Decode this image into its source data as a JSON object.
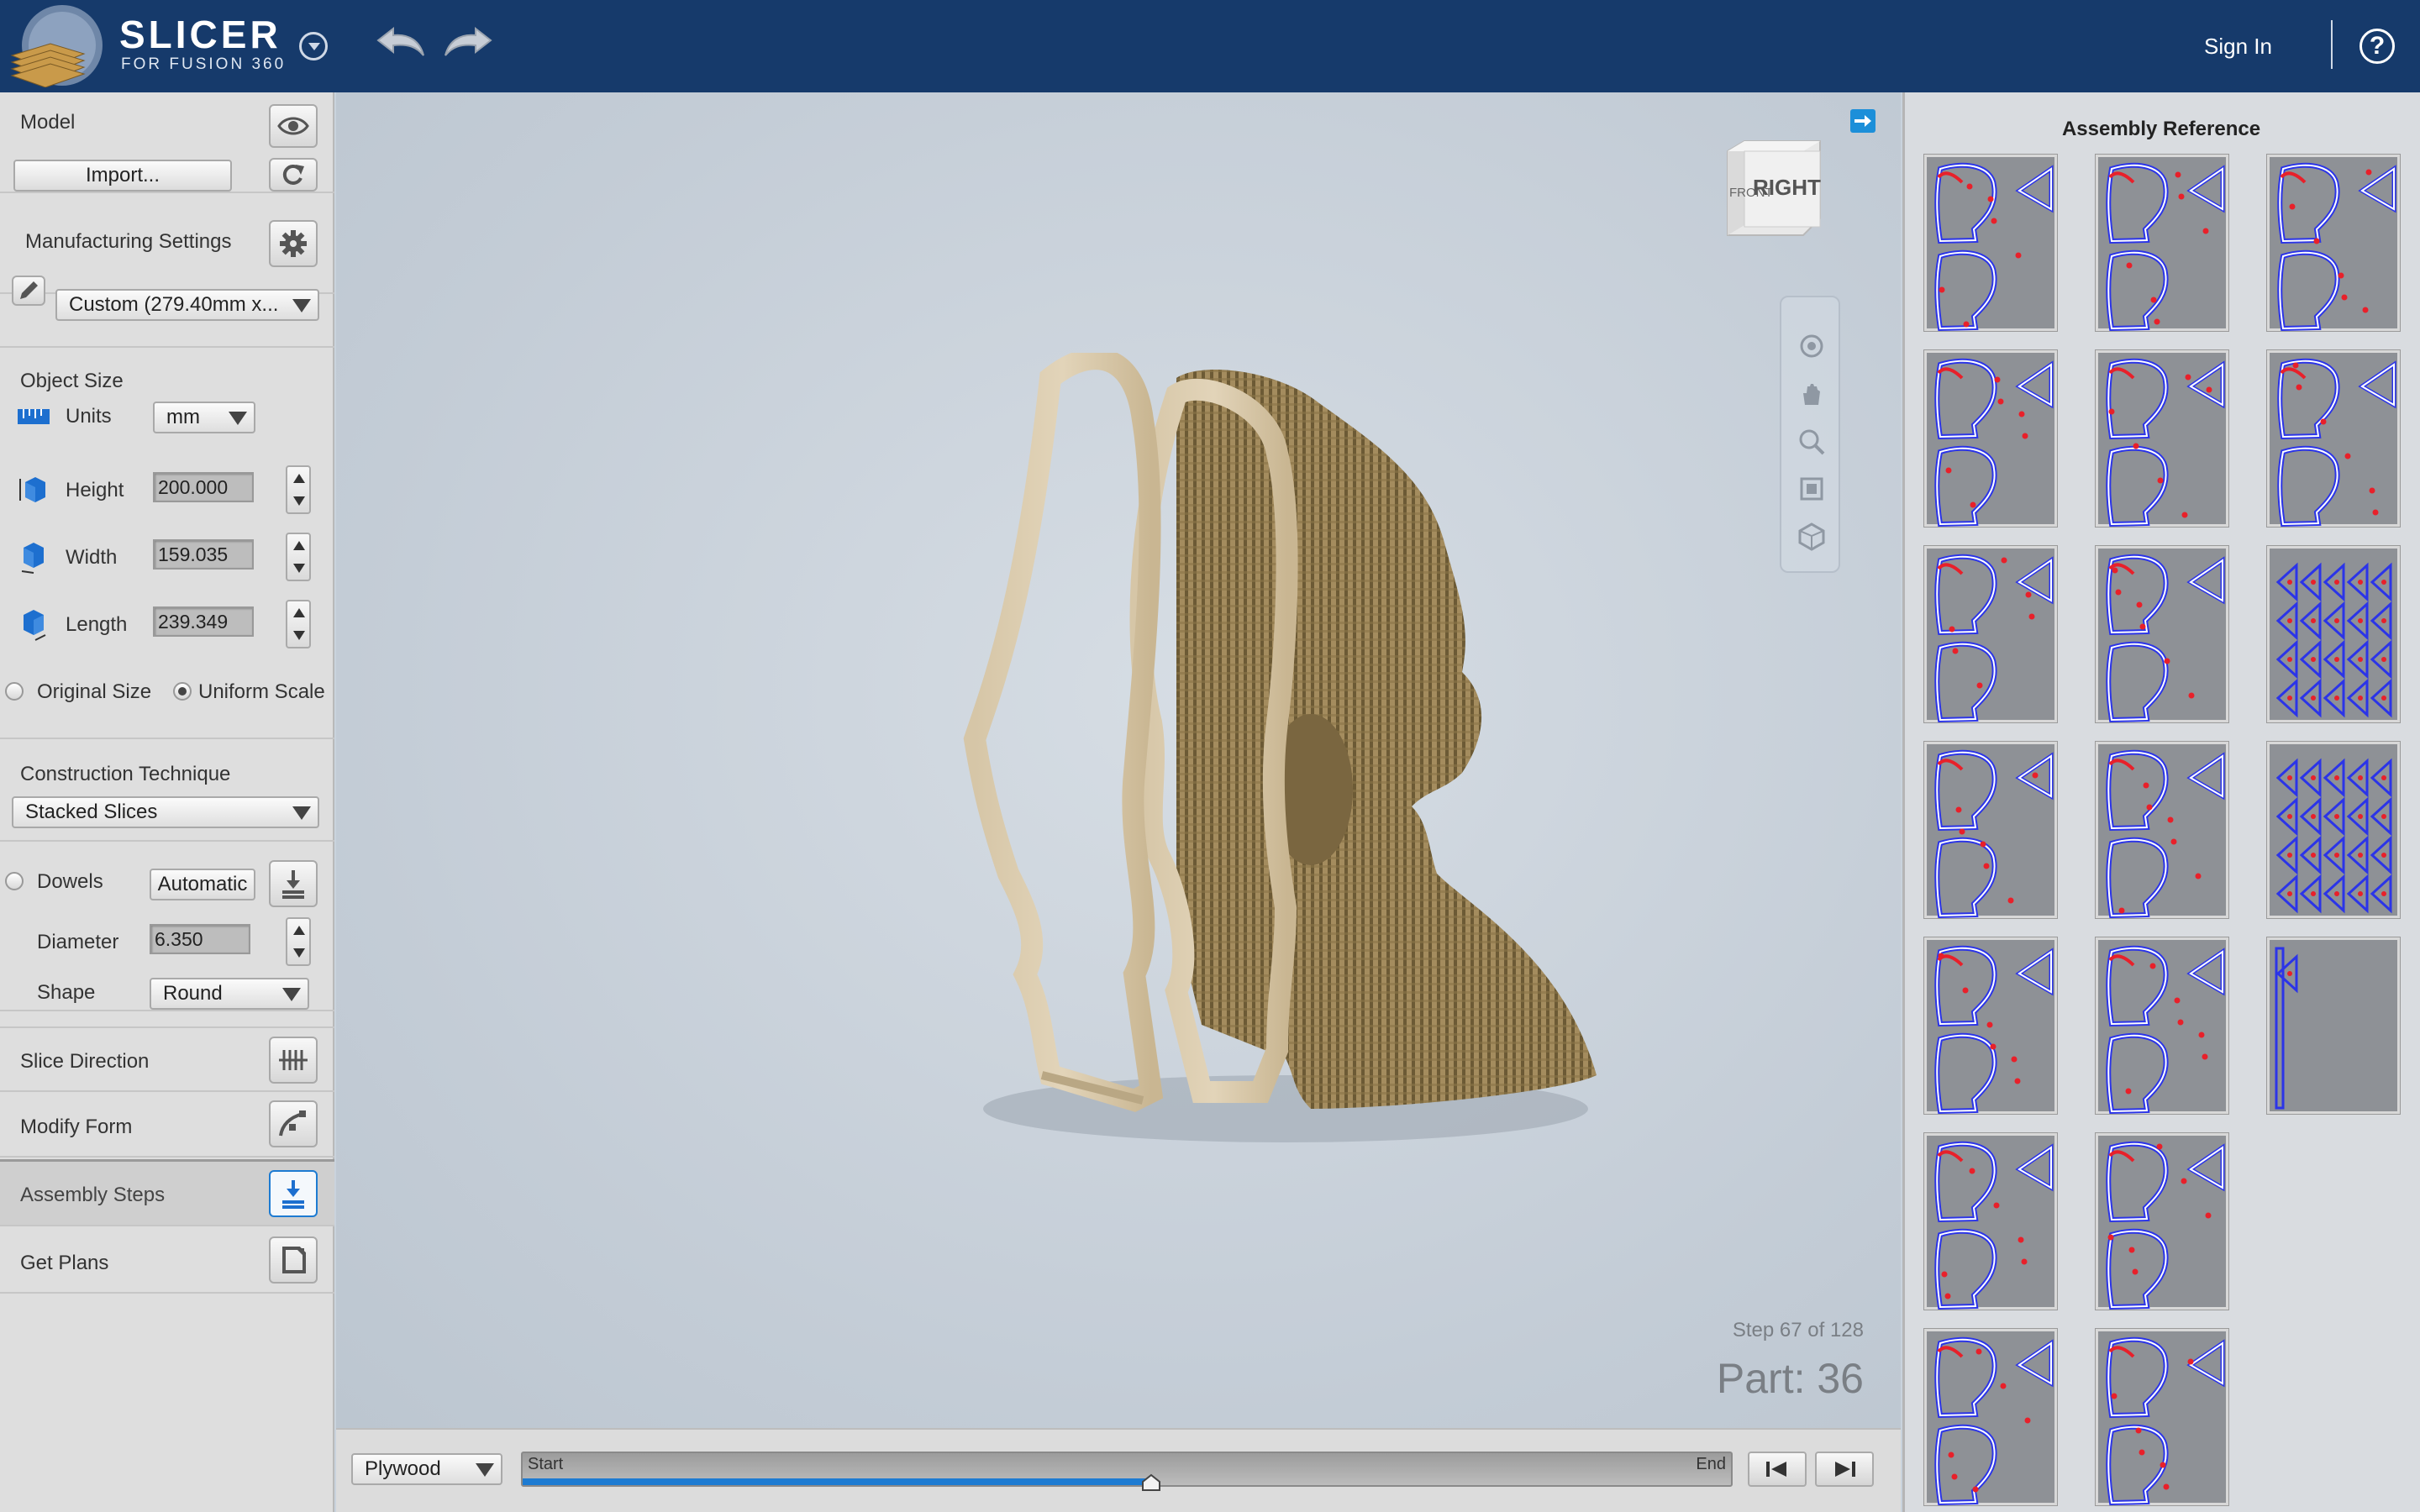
{
  "app": {
    "title": "SLICER",
    "subtitle": "FOR FUSION 360",
    "sign_in": "Sign In",
    "help": "?"
  },
  "left_panel": {
    "model": {
      "label": "Model",
      "import_button": "Import..."
    },
    "manufacturing": {
      "label": "Manufacturing Settings",
      "preset": "Custom (279.40mm x..."
    },
    "object_size": {
      "label": "Object Size",
      "units_label": "Units",
      "units_value": "mm",
      "height_label": "Height",
      "height_value": "200.000",
      "width_label": "Width",
      "width_value": "159.035",
      "length_label": "Length",
      "length_value": "239.349",
      "original_size": "Original Size",
      "uniform_scale": "Uniform Scale"
    },
    "construction": {
      "label": "Construction Technique",
      "value": "Stacked Slices"
    },
    "dowels": {
      "label": "Dowels",
      "automatic": "Automatic",
      "diameter_label": "Diameter",
      "diameter_value": "6.350",
      "shape_label": "Shape",
      "shape_value": "Round"
    },
    "sections": {
      "slice_direction": "Slice Direction",
      "modify_form": "Modify Form",
      "assembly_steps": "Assembly Steps",
      "get_plans": "Get Plans"
    }
  },
  "viewport": {
    "viewcube_front": "FRONT",
    "viewcube_right": "RIGHT",
    "step_text": "Step 67 of 128",
    "part_text": "Part: 36"
  },
  "bottom_bar": {
    "material": "Plywood",
    "timeline_start": "Start",
    "timeline_end": "End",
    "progress": 0.52
  },
  "right_panel": {
    "title": "Assembly Reference"
  },
  "colors": {
    "topbar": "#163a6b",
    "accent": "#1d7bd2",
    "sheet_outline": "#2b34e8",
    "sheet_mark": "#e8202a"
  }
}
